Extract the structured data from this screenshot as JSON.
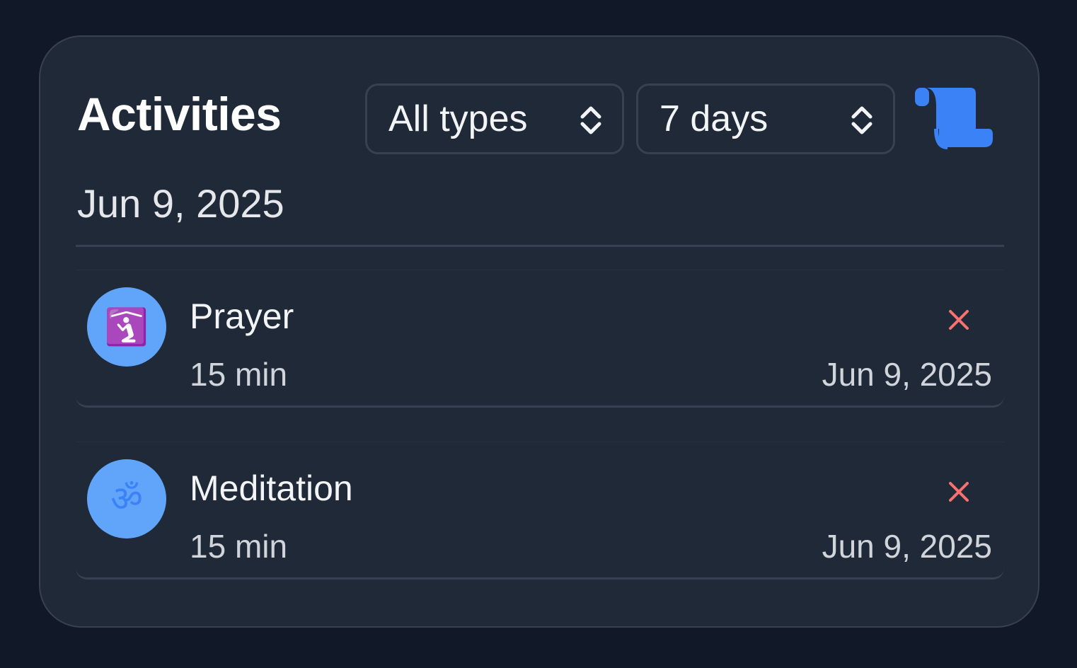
{
  "card": {
    "title": "Activities"
  },
  "filters": {
    "type_select": {
      "selected": "All types"
    },
    "range_select": {
      "selected": "7 days"
    }
  },
  "icons": {
    "scroll": "scroll-icon",
    "chevron": "chevron-up-down-icon",
    "delete": "close-icon"
  },
  "colors": {
    "accent": "#3b82f6",
    "avatar_bg": "#60a5fa",
    "delete": "#f87171",
    "card_bg": "#1f2937",
    "page_bg": "#111827"
  },
  "group": {
    "date": "Jun 9, 2025",
    "activities": [
      {
        "name": "Prayer",
        "icon": "prayer-icon",
        "glyph": "🛐",
        "duration": "15 min",
        "date": "Jun 9, 2025"
      },
      {
        "name": "Meditation",
        "icon": "om-icon",
        "glyph": "ॐ",
        "duration": "15 min",
        "date": "Jun 9, 2025"
      }
    ]
  }
}
